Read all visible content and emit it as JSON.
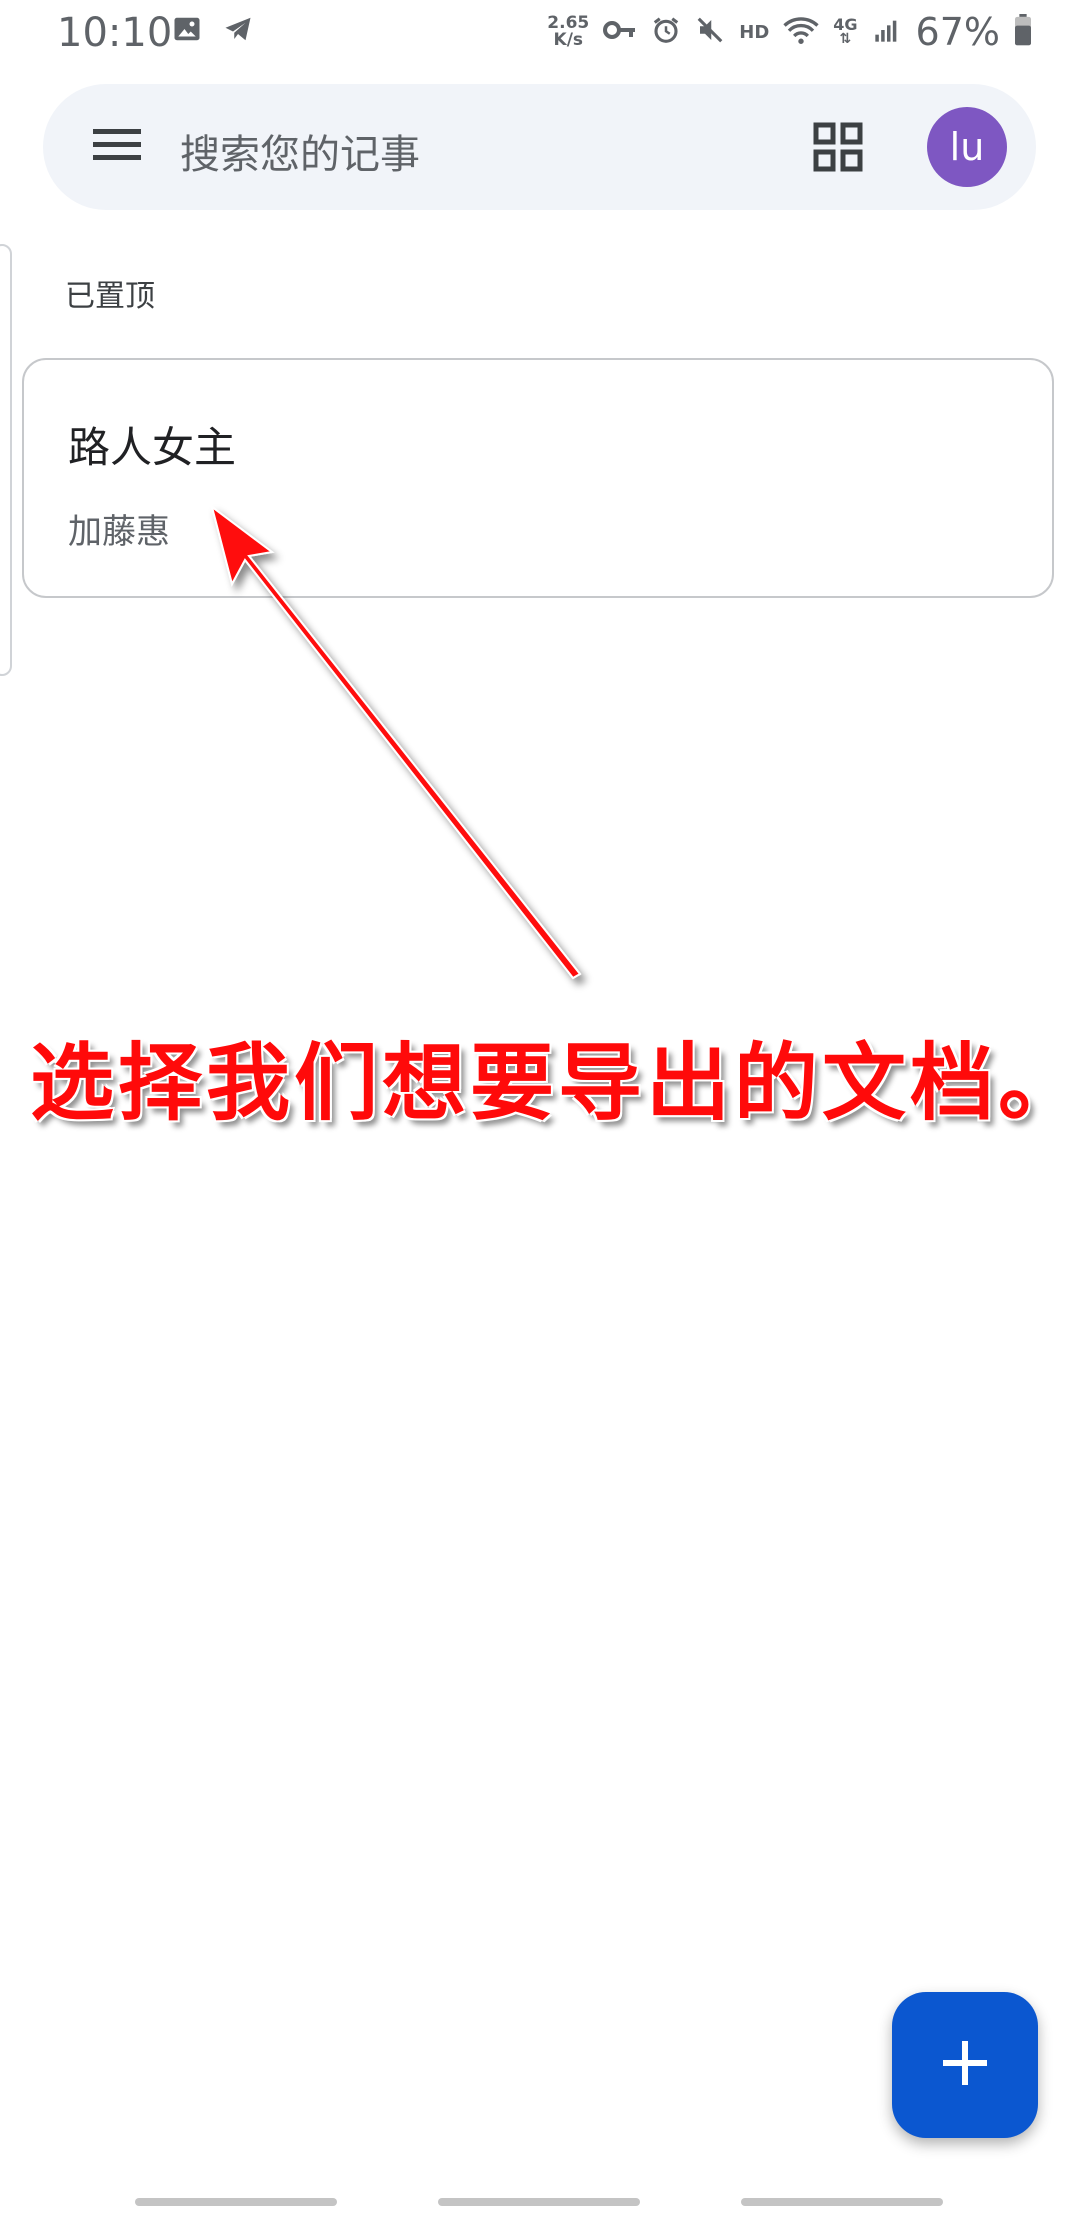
{
  "status_bar": {
    "time": "10:10",
    "netspeed_value": "2.65",
    "netspeed_unit": "K/s",
    "hd": "HD",
    "network": "4G",
    "battery": "67%",
    "icons": [
      "image-icon",
      "telegram-icon",
      "vpn-key-icon",
      "alarm-icon",
      "mute-icon",
      "wifi-icon",
      "signal-icon",
      "battery-icon"
    ]
  },
  "search": {
    "placeholder": "搜索您的记事",
    "avatar_initials": "lu"
  },
  "section": {
    "pinned_label": "已置顶"
  },
  "notes": [
    {
      "title": "路人女主",
      "body": "加藤惠"
    }
  ],
  "annotation": {
    "text": "选择我们想要导出的文档。",
    "color": "#ff0a0a"
  },
  "colors": {
    "fab": "#0b57d0",
    "avatar": "#7e57c2",
    "search_bg": "#f1f4f9"
  }
}
